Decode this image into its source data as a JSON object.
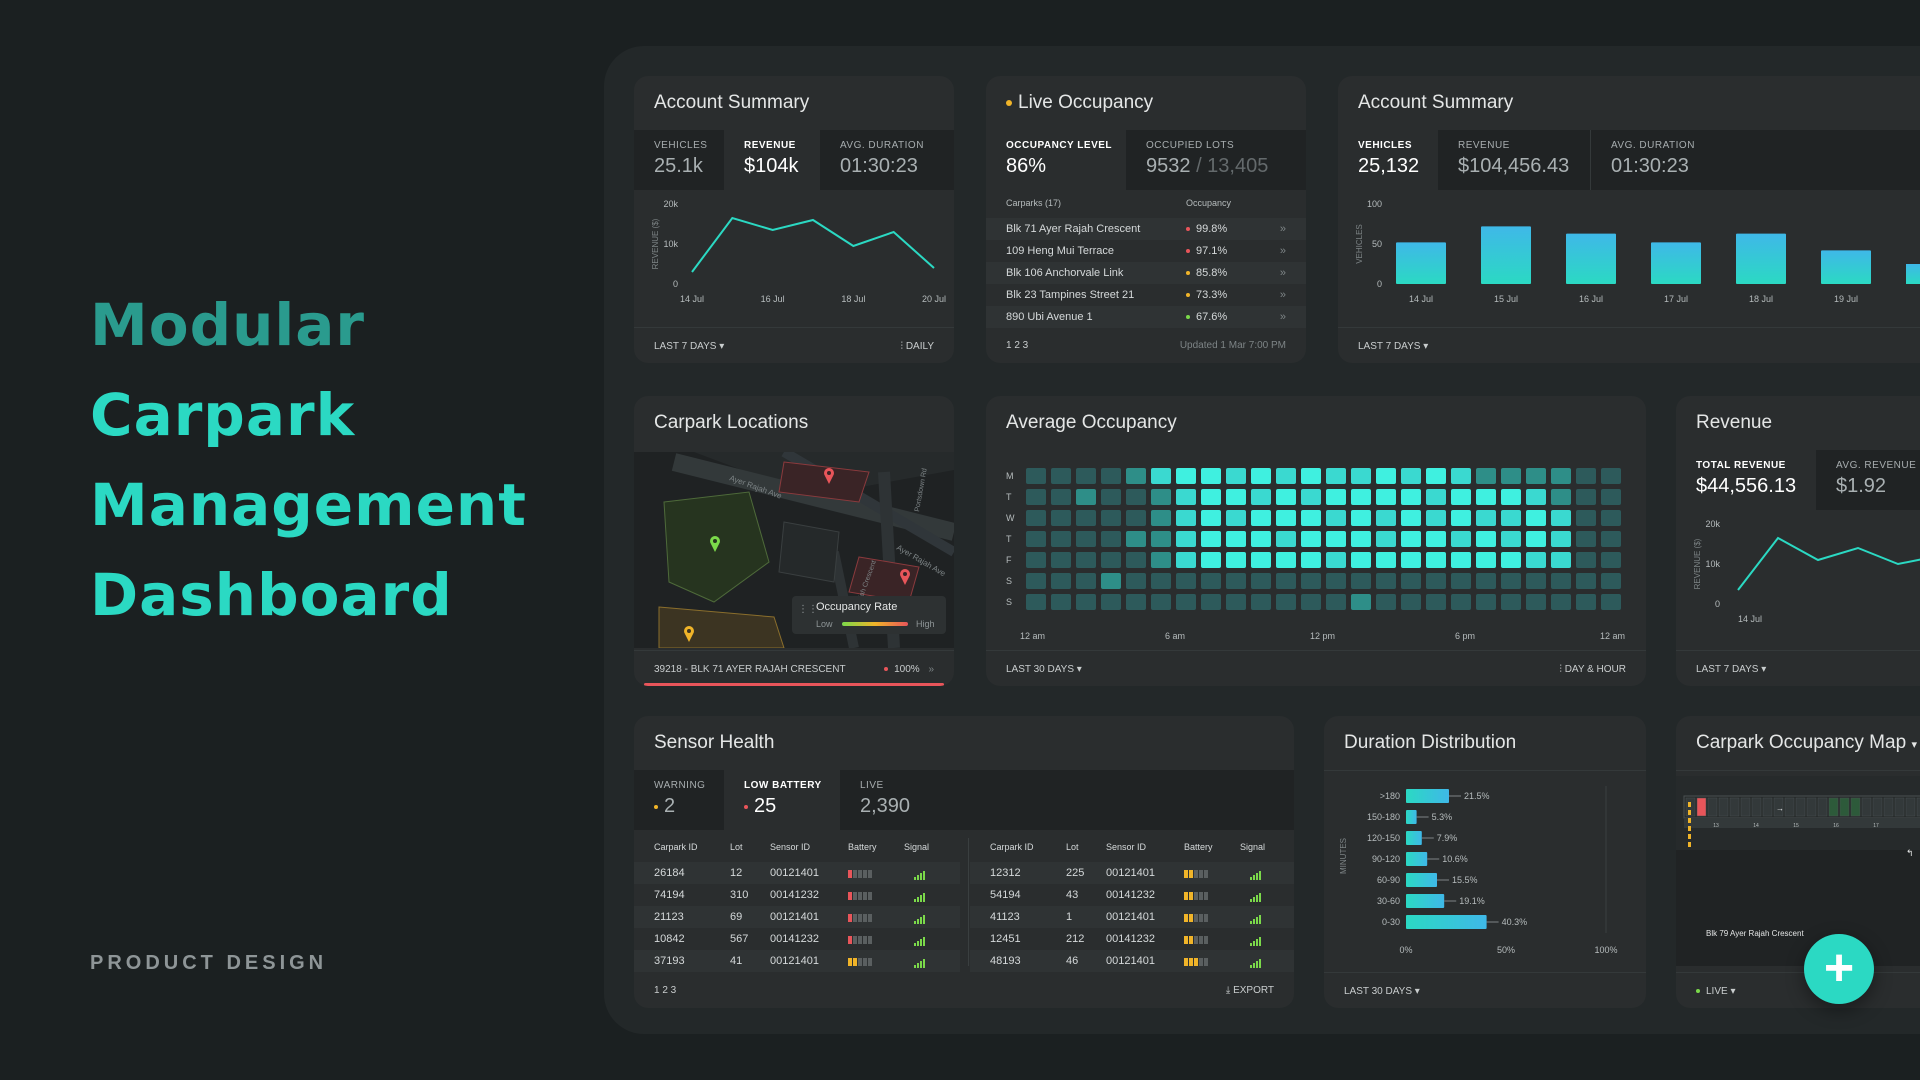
{
  "hero": {
    "lines": [
      "Modular",
      "Carpark",
      "Management",
      "Dashboard"
    ],
    "subtitle": "PRODUCT DESIGN"
  },
  "colors": {
    "accent": "#2bd9c3",
    "accent_dark": "#2a9b8e",
    "warning": "#f0b429",
    "danger": "#e8555a",
    "success": "#7bd94a"
  },
  "account1": {
    "title": "Account Summary",
    "stats": [
      {
        "label": "VEHICLES",
        "value": "25.1k"
      },
      {
        "label": "REVENUE",
        "value": "$104k"
      },
      {
        "label": "AVG. DURATION",
        "value": "01:30:23"
      }
    ],
    "ylabel": "REVENUE ($)",
    "yticks": [
      "20k",
      "10k",
      "0"
    ],
    "xticks": [
      "14 Jul",
      "16 Jul",
      "18 Jul",
      "20 Jul"
    ],
    "footer_left": "LAST 7 DAYS",
    "footer_right": "DAILY",
    "chart_data": {
      "type": "line",
      "x": [
        "14 Jul",
        "15 Jul",
        "16 Jul",
        "17 Jul",
        "18 Jul",
        "19 Jul",
        "20 Jul"
      ],
      "values": [
        3000,
        16500,
        13500,
        16000,
        9500,
        13000,
        4000
      ],
      "ylim": [
        0,
        20000
      ],
      "ylabel": "REVENUE ($)"
    }
  },
  "live": {
    "title": "Live Occupancy",
    "stats": [
      {
        "label": "OCCUPANCY LEVEL",
        "value": "86%"
      },
      {
        "label": "OCCUPIED LOTS",
        "value": "9532",
        "total": "/ 13,405"
      }
    ],
    "col_carparks": "Carparks (17)",
    "col_occupancy": "Occupancy",
    "rows": [
      {
        "name": "Blk 71 Ayer Rajah Crescent",
        "occ": "99.8%",
        "level": "high"
      },
      {
        "name": "109 Heng Mui Terrace",
        "occ": "97.1%",
        "level": "high"
      },
      {
        "name": "Blk 106 Anchorvale Link",
        "occ": "85.8%",
        "level": "mid"
      },
      {
        "name": "Blk 23 Tampines Street 21",
        "occ": "73.3%",
        "level": "mid"
      },
      {
        "name": "890 Ubi Avenue 1",
        "occ": "67.6%",
        "level": "low"
      }
    ],
    "pages": "1  2  3",
    "updated": "Updated 1 Mar 7:00 PM"
  },
  "account2": {
    "title": "Account Summary",
    "stats": [
      {
        "label": "VEHICLES",
        "value": "25,132"
      },
      {
        "label": "REVENUE",
        "value": "$104,456.43"
      },
      {
        "label": "AVG. DURATION",
        "value": "01:30:23"
      }
    ],
    "ylabel": "VEHICLES",
    "yticks": [
      "100",
      "50",
      "0"
    ],
    "footer_left": "LAST 7 DAYS",
    "chart_data": {
      "type": "bar",
      "categories": [
        "14 Jul",
        "15 Jul",
        "16 Jul",
        "17 Jul",
        "18 Jul",
        "19 Jul"
      ],
      "values": [
        52,
        72,
        63,
        52,
        63,
        42
      ],
      "ylim": [
        0,
        100
      ],
      "ylabel": "VEHICLES"
    }
  },
  "locations": {
    "title": "Carpark Locations",
    "streets": [
      "Ayer Rajah Ave",
      "Ayer Rajah Ave",
      "Ayer Rajah Crescent",
      "Portsdown Rd"
    ],
    "legend_title": "Occupancy Rate",
    "legend_low": "Low",
    "legend_high": "High",
    "footer_left": "39218 - BLK 71 AYER RAJAH CRESCENT",
    "footer_value": "100%"
  },
  "average": {
    "title": "Average Occupancy",
    "days": [
      "M",
      "T",
      "W",
      "T",
      "F",
      "S",
      "S"
    ],
    "xticks": [
      "12 am",
      "6 am",
      "12 pm",
      "6 pm",
      "12 am"
    ],
    "footer_left": "LAST 30 DAYS",
    "footer_right": "DAY & HOUR",
    "chart_data": {
      "type": "heatmap",
      "y": [
        "M",
        "T",
        "W",
        "T",
        "F",
        "S",
        "S"
      ],
      "x": [
        "0",
        "1",
        "2",
        "3",
        "4",
        "5",
        "6",
        "7",
        "8",
        "9",
        "10",
        "11",
        "12",
        "13",
        "14",
        "15",
        "16",
        "17",
        "18",
        "19",
        "20",
        "21",
        "22",
        "23"
      ],
      "values": [
        [
          1,
          1,
          1,
          1,
          2,
          3,
          4,
          4,
          3,
          4,
          3,
          4,
          3,
          3,
          4,
          3,
          4,
          3,
          2,
          2,
          2,
          2,
          1,
          1
        ],
        [
          1,
          1,
          2,
          1,
          1,
          2,
          3,
          4,
          4,
          3,
          4,
          3,
          4,
          4,
          4,
          4,
          3,
          4,
          4,
          4,
          3,
          2,
          1,
          1
        ],
        [
          1,
          1,
          1,
          1,
          1,
          2,
          3,
          4,
          3,
          4,
          4,
          4,
          3,
          4,
          3,
          4,
          3,
          4,
          3,
          3,
          4,
          3,
          1,
          1
        ],
        [
          1,
          1,
          1,
          1,
          2,
          2,
          3,
          4,
          4,
          4,
          3,
          4,
          4,
          4,
          3,
          4,
          4,
          3,
          4,
          3,
          4,
          3,
          1,
          1
        ],
        [
          1,
          1,
          1,
          1,
          1,
          2,
          3,
          4,
          4,
          4,
          4,
          4,
          3,
          4,
          4,
          4,
          4,
          4,
          4,
          4,
          3,
          3,
          1,
          1
        ],
        [
          1,
          1,
          1,
          2,
          1,
          1,
          1,
          1,
          1,
          1,
          1,
          1,
          1,
          1,
          1,
          1,
          1,
          1,
          1,
          1,
          1,
          1,
          1,
          1
        ],
        [
          1,
          1,
          1,
          1,
          1,
          1,
          1,
          1,
          1,
          1,
          1,
          1,
          1,
          2,
          1,
          1,
          1,
          1,
          1,
          1,
          1,
          1,
          1,
          1
        ]
      ]
    }
  },
  "revenue": {
    "title": "Revenue",
    "stats": [
      {
        "label": "TOTAL REVENUE",
        "value": "$44,556.13"
      },
      {
        "label": "AVG. REVENUE PER",
        "value": "$1.92"
      }
    ],
    "ylabel": "REVENUE ($)",
    "yticks": [
      "20k",
      "10k",
      "0"
    ],
    "xticks": [
      "14 Jul"
    ],
    "footer_left": "LAST 7 DAYS",
    "chart_data": {
      "type": "line",
      "x": [
        "14 Jul",
        "15 Jul",
        "16 Jul",
        "17 Jul",
        "18 Jul",
        "19 Jul"
      ],
      "values": [
        3500,
        16500,
        11000,
        14000,
        10000,
        12000
      ],
      "ylim": [
        0,
        20000
      ],
      "ylabel": "REVENUE ($)"
    }
  },
  "sensor": {
    "title": "Sensor Health",
    "stats": [
      {
        "label": "WARNING",
        "value": "2"
      },
      {
        "label": "LOW BATTERY",
        "value": "25"
      },
      {
        "label": "LIVE",
        "value": "2,390"
      }
    ],
    "columns": [
      "Carpark ID",
      "Lot",
      "Sensor ID",
      "Battery",
      "Signal"
    ],
    "left_rows": [
      {
        "cid": "26184",
        "lot": "12",
        "sid": "00121401",
        "batt": 1
      },
      {
        "cid": "74194",
        "lot": "310",
        "sid": "00141232",
        "batt": 1
      },
      {
        "cid": "21123",
        "lot": "69",
        "sid": "00121401",
        "batt": 1
      },
      {
        "cid": "10842",
        "lot": "567",
        "sid": "00141232",
        "batt": 1
      },
      {
        "cid": "37193",
        "lot": "41",
        "sid": "00121401",
        "batt": 2
      }
    ],
    "right_rows": [
      {
        "cid": "12312",
        "lot": "225",
        "sid": "00121401",
        "batt": 2
      },
      {
        "cid": "54194",
        "lot": "43",
        "sid": "00141232",
        "batt": 2
      },
      {
        "cid": "41123",
        "lot": "1",
        "sid": "00121401",
        "batt": 2
      },
      {
        "cid": "12451",
        "lot": "212",
        "sid": "00141232",
        "batt": 2
      },
      {
        "cid": "48193",
        "lot": "46",
        "sid": "00121401",
        "batt": 3
      }
    ],
    "pages": "1  2  3",
    "export": "EXPORT"
  },
  "duration": {
    "title": "Duration Distribution",
    "ylabel": "MINUTES",
    "xticks": [
      "0%",
      "50%",
      "100%"
    ],
    "footer_left": "LAST 30 DAYS",
    "chart_data": {
      "type": "bar",
      "categories": [
        ">180",
        "150-180",
        "120-150",
        "90-120",
        "60-90",
        "30-60",
        "0-30"
      ],
      "values": [
        21.5,
        5.3,
        7.9,
        10.6,
        15.5,
        19.1,
        40.3
      ],
      "labels": [
        "21.5%",
        "5.3%",
        "7.9%",
        "10.6%",
        "15.5%",
        "19.1%",
        "40.3%"
      ],
      "xlim": [
        0,
        100
      ],
      "ylabel": "MINUTES"
    }
  },
  "occmap": {
    "title": "Carpark Occupancy Map",
    "caption": "Blk 79 Ayer Rajah Crescent",
    "footer_left": "LIVE",
    "lot_numbers": [
      "13",
      "14",
      "15",
      "16",
      "17"
    ]
  },
  "fab": {
    "label": "+"
  }
}
